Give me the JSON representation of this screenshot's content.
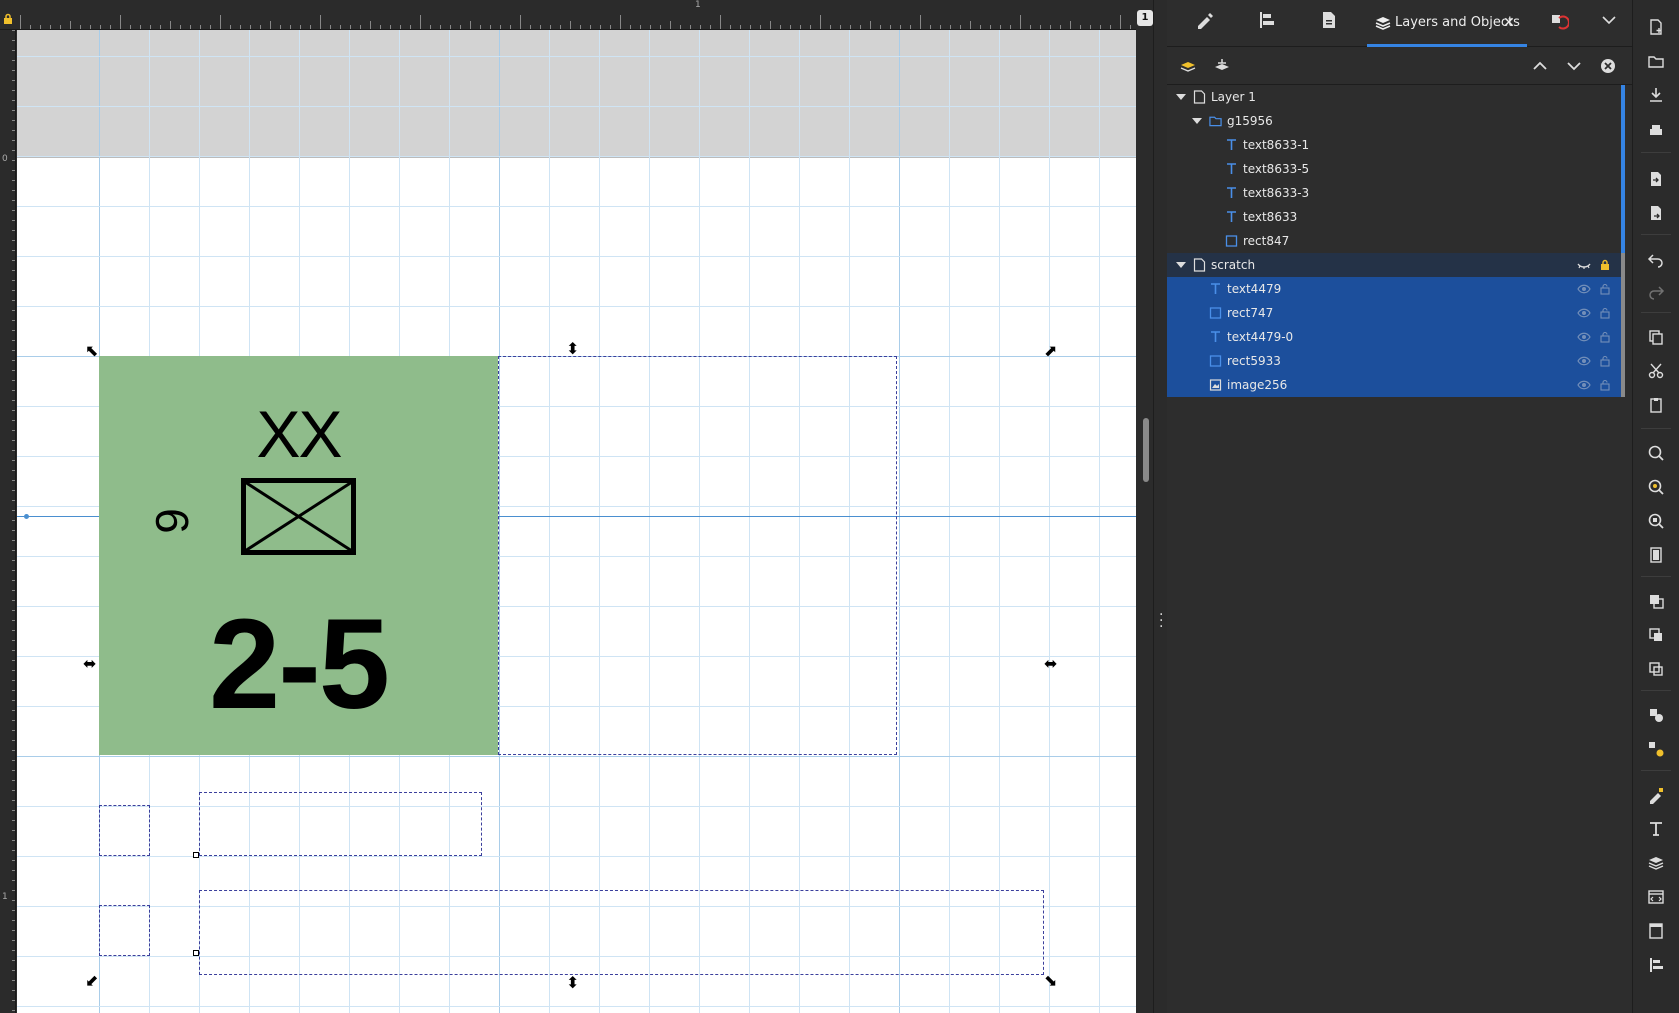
{
  "ruler": {
    "top_marker": "1",
    "left_labels": [
      "0",
      "1"
    ],
    "page_number": "1"
  },
  "counter": {
    "unit_size": "XX",
    "unit_id": "9",
    "strength": "2-5",
    "fill_color": "#8fbc8b"
  },
  "dock": {
    "active_tab": "Layers and Objects",
    "tree": [
      {
        "name": "Layer 1",
        "kind": "layer",
        "expanded": true
      },
      {
        "name": "g15956",
        "kind": "group",
        "expanded": true
      },
      {
        "name": "text8633-1",
        "kind": "text"
      },
      {
        "name": "text8633-5",
        "kind": "text"
      },
      {
        "name": "text8633-3",
        "kind": "text"
      },
      {
        "name": "text8633",
        "kind": "text"
      },
      {
        "name": "rect847",
        "kind": "rect"
      },
      {
        "name": "scratch",
        "kind": "layer",
        "expanded": true
      },
      {
        "name": "text4479",
        "kind": "text",
        "selected": true
      },
      {
        "name": "rect747",
        "kind": "rect",
        "selected": true
      },
      {
        "name": "text4479-0",
        "kind": "text",
        "selected": true
      },
      {
        "name": "rect5933",
        "kind": "rect",
        "selected": true
      },
      {
        "name": "image256",
        "kind": "image",
        "selected": true
      }
    ]
  },
  "colors": {
    "accent": "#3584e4",
    "selection": "#1c4f9c",
    "guide": "#4a8fd0",
    "dash": "#3b3f9c"
  }
}
